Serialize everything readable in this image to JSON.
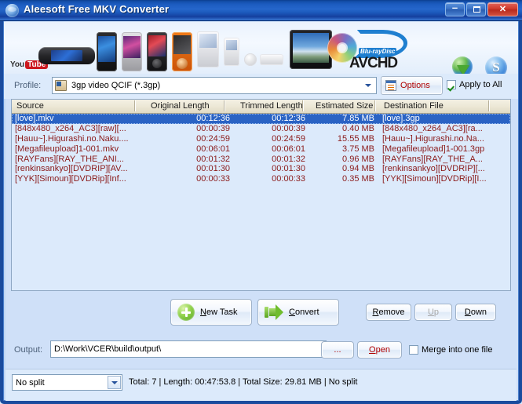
{
  "window": {
    "title": "Aleesoft Free MKV Converter",
    "app_icon": "globe-app-icon",
    "minimize_label": "–",
    "maximize_label": "",
    "close_label": "✕"
  },
  "banner": {
    "youtube_prefix": "You",
    "youtube_tube": "Tube",
    "bluray_label": "Blu-rayDisc",
    "avchd_label": "AVCHD",
    "download_icon": "download-globe-icon",
    "support_icon": "skype-s-icon",
    "support_letter": "S"
  },
  "profile": {
    "label": "Profile:",
    "selected": "3gp video QCIF (*.3gp)",
    "icon": "video-file-icon",
    "options_label": "Options",
    "options_accel": "O",
    "apply_to_all_label": "Apply to All",
    "apply_to_all_checked": true
  },
  "list": {
    "columns": [
      "Source",
      "Original Length",
      "Trimmed Length",
      "Estimated Size",
      "Destination File"
    ],
    "rows": [
      {
        "source": "[love].mkv",
        "original": "00:12:36",
        "trimmed": "00:12:36",
        "size": "7.85 MB",
        "destination": "[love].3gp",
        "selected": true
      },
      {
        "source": "[848x480_x264_AC3][raw][...",
        "original": "00:00:39",
        "trimmed": "00:00:39",
        "size": "0.40 MB",
        "destination": "[848x480_x264_AC3][ra...",
        "selected": false
      },
      {
        "source": "[Hauu~].Higurashi.no.Naku....",
        "original": "00:24:59",
        "trimmed": "00:24:59",
        "size": "15.55 MB",
        "destination": "[Hauu~].Higurashi.no.Na...",
        "selected": false
      },
      {
        "source": "[Megafileupload]1-001.mkv",
        "original": "00:06:01",
        "trimmed": "00:06:01",
        "size": "3.75 MB",
        "destination": "[Megafileupload]1-001.3gp",
        "selected": false
      },
      {
        "source": "[RAYFans][RAY_THE_ANI...",
        "original": "00:01:32",
        "trimmed": "00:01:32",
        "size": "0.96 MB",
        "destination": "[RAYFans][RAY_THE_A...",
        "selected": false
      },
      {
        "source": "[renkinsankyo][DVDRIP][AV...",
        "original": "00:01:30",
        "trimmed": "00:01:30",
        "size": "0.94 MB",
        "destination": "[renkinsankyo][DVDRIP][...",
        "selected": false
      },
      {
        "source": "[YYK][Simoun][DVDRip][Inf...",
        "original": "00:00:33",
        "trimmed": "00:00:33",
        "size": "0.35 MB",
        "destination": "[YYK][Simoun][DVDRip][I...",
        "selected": false
      }
    ]
  },
  "actions": {
    "new_task": {
      "accel": "N",
      "rest": "ew Task",
      "icon": "add-plus-icon"
    },
    "convert": {
      "accel": "C",
      "rest": "onvert",
      "icon": "green-arrow-icon"
    },
    "remove": {
      "accel": "R",
      "rest": "emove"
    },
    "up": {
      "accel": "U",
      "rest": "p",
      "disabled": true
    },
    "down": {
      "accel": "D",
      "rest": "own"
    }
  },
  "output": {
    "label": "Output:",
    "path": "D:\\Work\\VCER\\build\\output\\",
    "browse_label": "...",
    "open_label": "Open",
    "open_accel": "O",
    "merge_label": "Merge into one file",
    "merge_checked": false
  },
  "status": {
    "split_mode": "No split",
    "summary": "Total: 7 | Length: 00:47:53.8 | Total Size: 29.81 MB | No split"
  },
  "colors": {
    "title_blue": "#1d5cc0",
    "panel_blue": "#dceafb",
    "row_text_red": "#8b1a1a",
    "selection_blue": "#2a63c4",
    "accent_red": "#b00000",
    "header_beige": "#ece7d5"
  }
}
